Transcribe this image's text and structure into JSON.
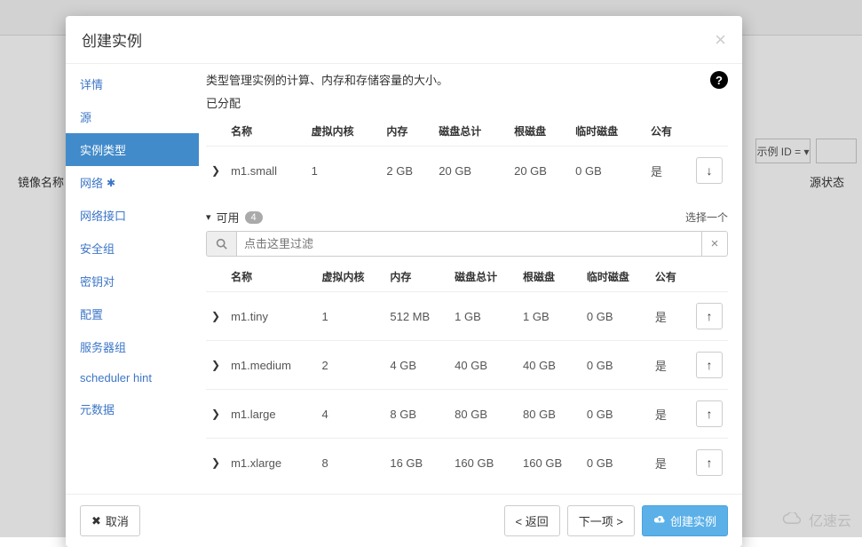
{
  "bg": {
    "label_left": "镜像名称",
    "label_right": "源状态",
    "dropdown": "示例 ID = ▾"
  },
  "modal": {
    "title": "创建实例",
    "sidebar": {
      "items": [
        {
          "label": "详情"
        },
        {
          "label": "源"
        },
        {
          "label": "实例类型"
        },
        {
          "label": "网络",
          "starred": true
        },
        {
          "label": "网络接口"
        },
        {
          "label": "安全组"
        },
        {
          "label": "密钥对"
        },
        {
          "label": "配置"
        },
        {
          "label": "服务器组"
        },
        {
          "label": "scheduler hint"
        },
        {
          "label": "元数据"
        }
      ],
      "active_index": 2
    },
    "description": "类型管理实例的计算、内存和存储容量的大小。",
    "allocated": {
      "title": "已分配",
      "headers": [
        "名称",
        "虚拟内核",
        "内存",
        "磁盘总计",
        "根磁盘",
        "临时磁盘",
        "公有"
      ],
      "rows": [
        {
          "name": "m1.small",
          "vcpus": "1",
          "ram": "2 GB",
          "disk_total": "20 GB",
          "root_disk": "20 GB",
          "eph_disk": "0 GB",
          "public": "是"
        }
      ]
    },
    "available": {
      "title": "可用",
      "count": "4",
      "hint": "选择一个",
      "filter_placeholder": "点击这里过滤",
      "headers": [
        "名称",
        "虚拟内核",
        "内存",
        "磁盘总计",
        "根磁盘",
        "临时磁盘",
        "公有"
      ],
      "rows": [
        {
          "name": "m1.tiny",
          "vcpus": "1",
          "ram": "512 MB",
          "disk_total": "1 GB",
          "root_disk": "1 GB",
          "eph_disk": "0 GB",
          "public": "是"
        },
        {
          "name": "m1.medium",
          "vcpus": "2",
          "ram": "4 GB",
          "disk_total": "40 GB",
          "root_disk": "40 GB",
          "eph_disk": "0 GB",
          "public": "是"
        },
        {
          "name": "m1.large",
          "vcpus": "4",
          "ram": "8 GB",
          "disk_total": "80 GB",
          "root_disk": "80 GB",
          "eph_disk": "0 GB",
          "public": "是"
        },
        {
          "name": "m1.xlarge",
          "vcpus": "8",
          "ram": "16 GB",
          "disk_total": "160 GB",
          "root_disk": "160 GB",
          "eph_disk": "0 GB",
          "public": "是"
        }
      ]
    },
    "footer": {
      "cancel": "取消",
      "back": "< 返回",
      "next": "下一项 >",
      "create": "创建实例"
    }
  },
  "watermark": "亿速云"
}
